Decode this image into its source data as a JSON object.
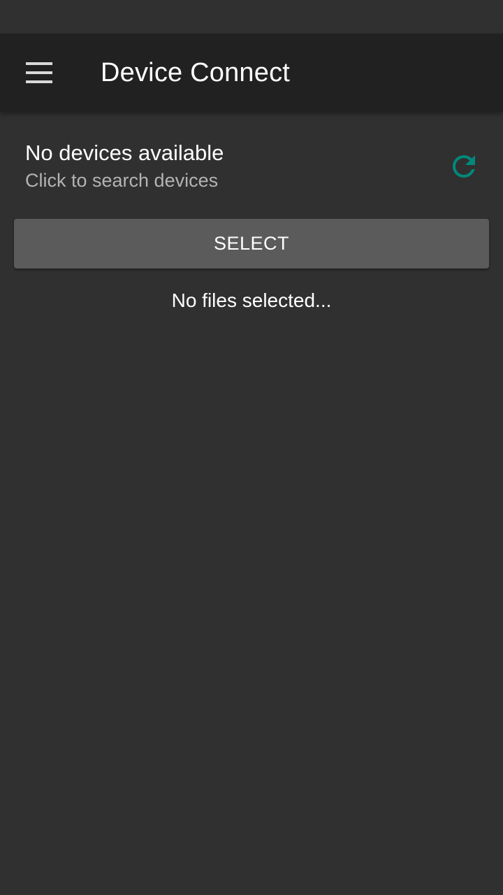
{
  "app_bar": {
    "title": "Device Connect",
    "menu_icon": "hamburger-menu-icon"
  },
  "device_status": {
    "title": "No devices available",
    "subtitle": "Click to search devices",
    "refresh_icon": "refresh-icon",
    "refresh_color": "#00897B"
  },
  "select_button": {
    "label": "SELECT"
  },
  "files": {
    "status": "No files selected..."
  },
  "colors": {
    "background": "#303030",
    "app_bar": "#212121",
    "button": "#5b5b5c",
    "accent": "#00897B"
  }
}
